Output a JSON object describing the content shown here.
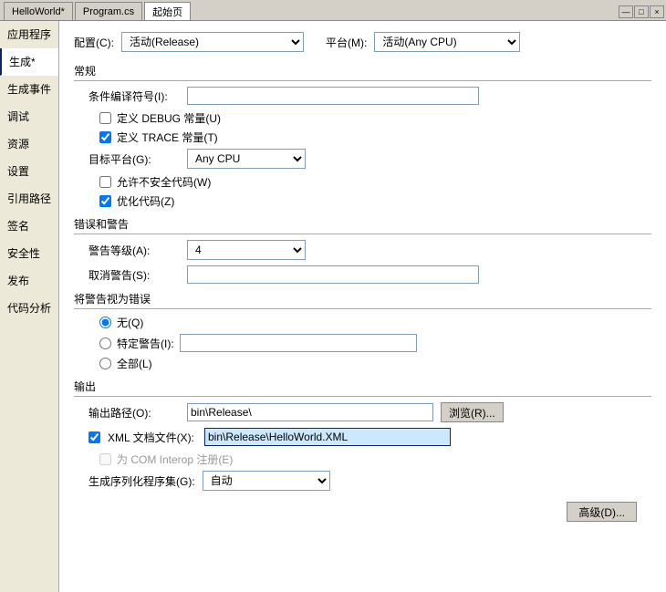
{
  "titlebar": {
    "tabs": [
      "HelloWorld*",
      "Program.cs",
      "起始页"
    ],
    "active_tab": 0,
    "close_label": "×",
    "minimize_label": "—",
    "restore_label": "□"
  },
  "sidebar": {
    "items": [
      {
        "label": "应用程序",
        "active": false
      },
      {
        "label": "生成*",
        "active": true
      },
      {
        "label": "生成事件",
        "active": false
      },
      {
        "label": "调试",
        "active": false
      },
      {
        "label": "资源",
        "active": false
      },
      {
        "label": "设置",
        "active": false
      },
      {
        "label": "引用路径",
        "active": false
      },
      {
        "label": "签名",
        "active": false
      },
      {
        "label": "安全性",
        "active": false
      },
      {
        "label": "发布",
        "active": false
      },
      {
        "label": "代码分析",
        "active": false
      }
    ]
  },
  "config": {
    "config_label": "配置(C):",
    "config_value": "活动(Release)",
    "platform_label": "平台(M):",
    "platform_value": "活动(Any CPU)"
  },
  "general": {
    "section_title": "常规",
    "conditional_compile_label": "条件编译符号(I):",
    "conditional_compile_value": "",
    "define_debug_label": "定义 DEBUG 常量(U)",
    "define_debug_checked": false,
    "define_trace_label": "定义 TRACE 常量(T)",
    "define_trace_checked": true,
    "target_platform_label": "目标平台(G):",
    "target_platform_value": "Any CPU",
    "allow_unsafe_label": "允许不安全代码(W)",
    "allow_unsafe_checked": false,
    "optimize_label": "优化代码(Z)",
    "optimize_checked": true
  },
  "errors": {
    "section_title": "错误和警告",
    "warning_level_label": "警告等级(A):",
    "warning_level_value": "4",
    "suppress_warnings_label": "取消警告(S):",
    "suppress_warnings_value": ""
  },
  "treat_warnings": {
    "section_title": "将警告视为错误",
    "none_label": "无(Q)",
    "specific_label": "特定警告(I):",
    "specific_value": "",
    "all_label": "全部(L)",
    "selected": "none"
  },
  "output": {
    "section_title": "输出",
    "output_path_label": "输出路径(O):",
    "output_path_value": "bin\\Release\\",
    "browse_label": "浏览(R)...",
    "xml_doc_label": "XML 文档文件(X):",
    "xml_doc_value": "bin\\Release\\HelloWorld.XML",
    "xml_doc_checked": true,
    "com_interop_label": "为 COM Interop 注册(E)",
    "com_interop_checked": false,
    "serialization_label": "生成序列化程序集(G):",
    "serialization_value": "自动",
    "advanced_label": "高级(D)..."
  }
}
